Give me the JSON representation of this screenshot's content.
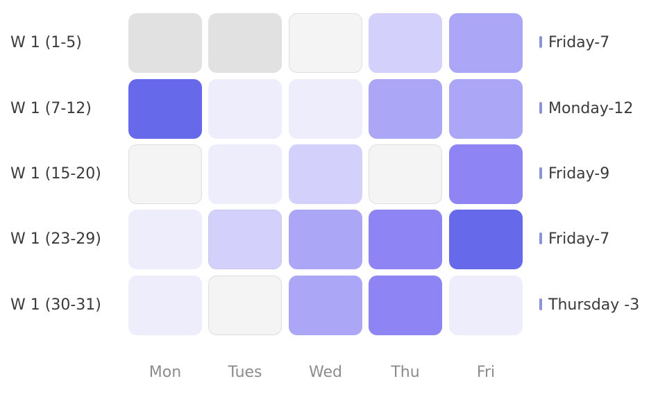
{
  "chart_data": {
    "type": "heatmap",
    "title": "",
    "categories": [
      "Mon",
      "Tues",
      "Wed",
      "Thu",
      "Fri"
    ],
    "rows": [
      {
        "label": "W 1 (1-5)",
        "values": [
          0,
          0,
          0,
          2,
          4
        ],
        "note": "Friday-7"
      },
      {
        "label": "W 1 (7-12)",
        "values": [
          6,
          1,
          1,
          4,
          4
        ],
        "note": "Monday-12"
      },
      {
        "label": "W 1 (15-20)",
        "values": [
          0,
          1,
          2,
          0,
          5
        ],
        "note": "Friday-9"
      },
      {
        "label": "W 1 (23-29)",
        "values": [
          1,
          2,
          4,
          5,
          6
        ],
        "note": "Friday-7"
      },
      {
        "label": "W 1 (30-31)",
        "values": [
          1,
          0,
          4,
          5,
          1
        ],
        "note": "Thursday -3"
      }
    ],
    "neutral_rows_gray": [
      [
        true,
        true,
        false,
        false,
        false
      ],
      [
        false,
        false,
        false,
        false,
        false
      ],
      [
        false,
        false,
        false,
        false,
        false
      ],
      [
        false,
        false,
        false,
        false,
        false
      ],
      [
        false,
        false,
        false,
        false,
        false
      ]
    ],
    "color_scale": [
      "#f4f4f4",
      "#eeedfc",
      "#d3d0fb",
      "#c2bef9",
      "#aba7f6",
      "#8e84f4",
      "#6569ea"
    ],
    "gray_shades": {
      "dark": "#e1e1e1",
      "light": "#f4f4f4"
    }
  }
}
